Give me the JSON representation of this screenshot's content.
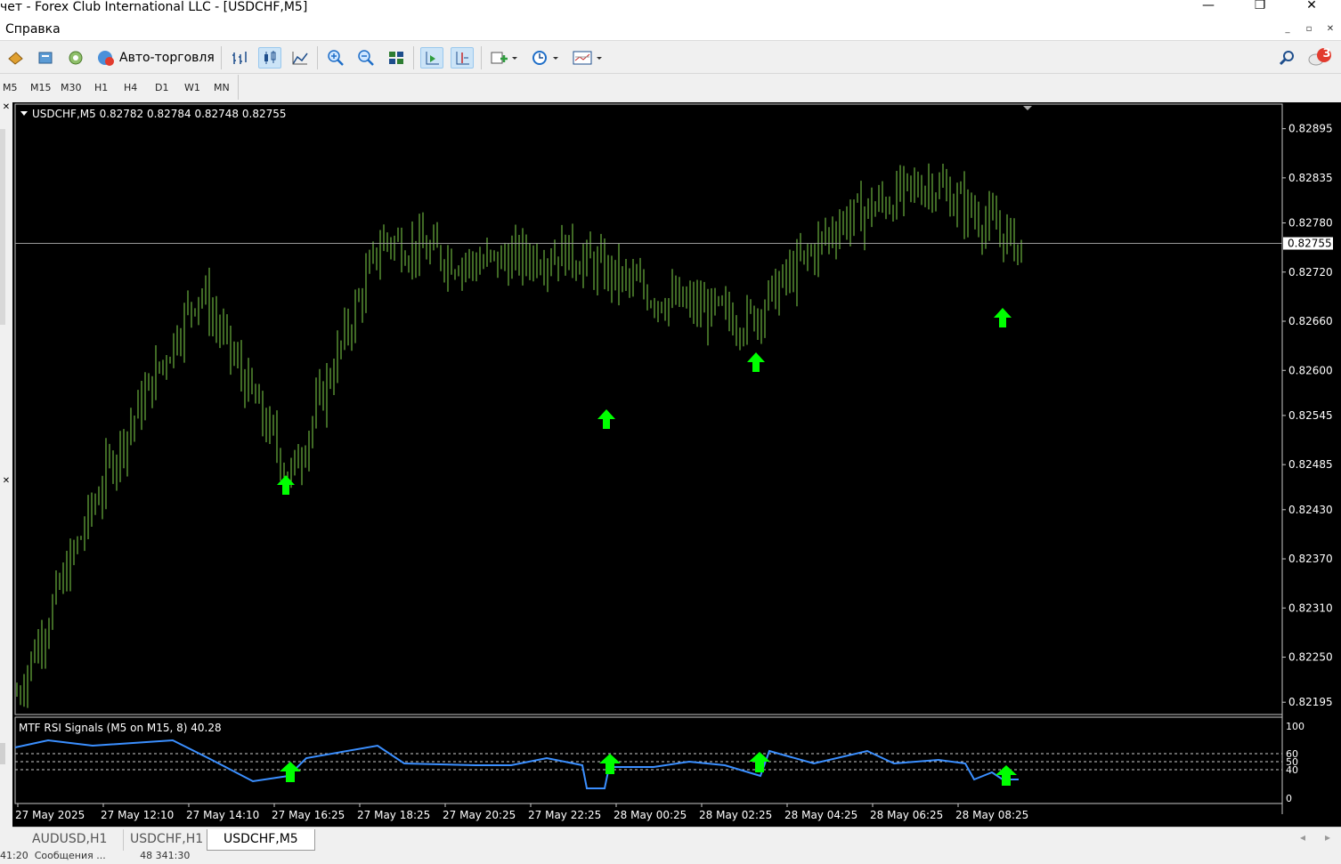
{
  "window": {
    "title": "чет - Forex Club International LLC - [USDCHF,M5]",
    "controls": {
      "minimize": "—",
      "restore": "❐",
      "close": "✕"
    }
  },
  "menu": {
    "help": "Справка",
    "mdi_minimize": "_",
    "mdi_restore": "▫",
    "mdi_close": "✕"
  },
  "toolbar": {
    "auto_trading": "Авто-торговля",
    "alerts_badge": "3"
  },
  "timeframes": [
    "M5",
    "M15",
    "M30",
    "H1",
    "H4",
    "D1",
    "W1",
    "MN"
  ],
  "chart": {
    "header": "USDCHF,M5  0.82782 0.82784 0.82748 0.82755",
    "current_price": "0.82755",
    "price_labels": [
      "0.82895",
      "0.82835",
      "0.82780",
      "0.82720",
      "0.82660",
      "0.82600",
      "0.82545",
      "0.82485",
      "0.82430",
      "0.82370",
      "0.82310",
      "0.82250",
      "0.82195"
    ],
    "indicator_header": "MTF RSI Signals (M5 on M15, 8) 40.28",
    "indicator_levels": [
      "100",
      "60",
      "50",
      "40",
      "0"
    ],
    "time_labels": [
      "27 May 2025",
      "27 May 12:10",
      "27 May 14:10",
      "27 May 16:25",
      "27 May 18:25",
      "27 May 20:25",
      "27 May 22:25",
      "28 May 00:25",
      "28 May 02:25",
      "28 May 04:25",
      "28 May 06:25",
      "28 May 08:25"
    ],
    "colors": {
      "background": "#000000",
      "candles": "#7fd44a",
      "signal_arrow": "#00ff00",
      "rsi_line": "#3b8fff",
      "grid_line": "#9a9a9a"
    }
  },
  "chart_data": {
    "type": "line",
    "title": "USDCHF,M5",
    "ylim": [
      0.8218,
      0.82925
    ],
    "x": [
      "27 May 2025",
      "27 May 12:10",
      "27 May 14:10",
      "27 May 16:25",
      "27 May 18:25",
      "27 May 20:25",
      "27 May 22:25",
      "28 May 00:25",
      "28 May 02:25",
      "28 May 04:25",
      "28 May 06:25",
      "28 May 08:25"
    ],
    "series": [
      {
        "name": "USDCHF,M5",
        "values": [
          0.82205,
          0.8248,
          0.827,
          0.8247,
          0.8276,
          0.8273,
          0.82745,
          0.8269,
          0.8266,
          0.8278,
          0.8283,
          0.8275
        ]
      }
    ],
    "buy_signals": [
      "27 May 16:25",
      "27 May 23:50",
      "28 May 02:55",
      "28 May 08:45"
    ],
    "last_price": 0.82755
  },
  "tabs": [
    "AUDUSD,H1",
    "USDCHF,H1",
    "USDCHF,M5"
  ],
  "status": {
    "text": "41:20  Сообщения ...           48 341:30"
  }
}
